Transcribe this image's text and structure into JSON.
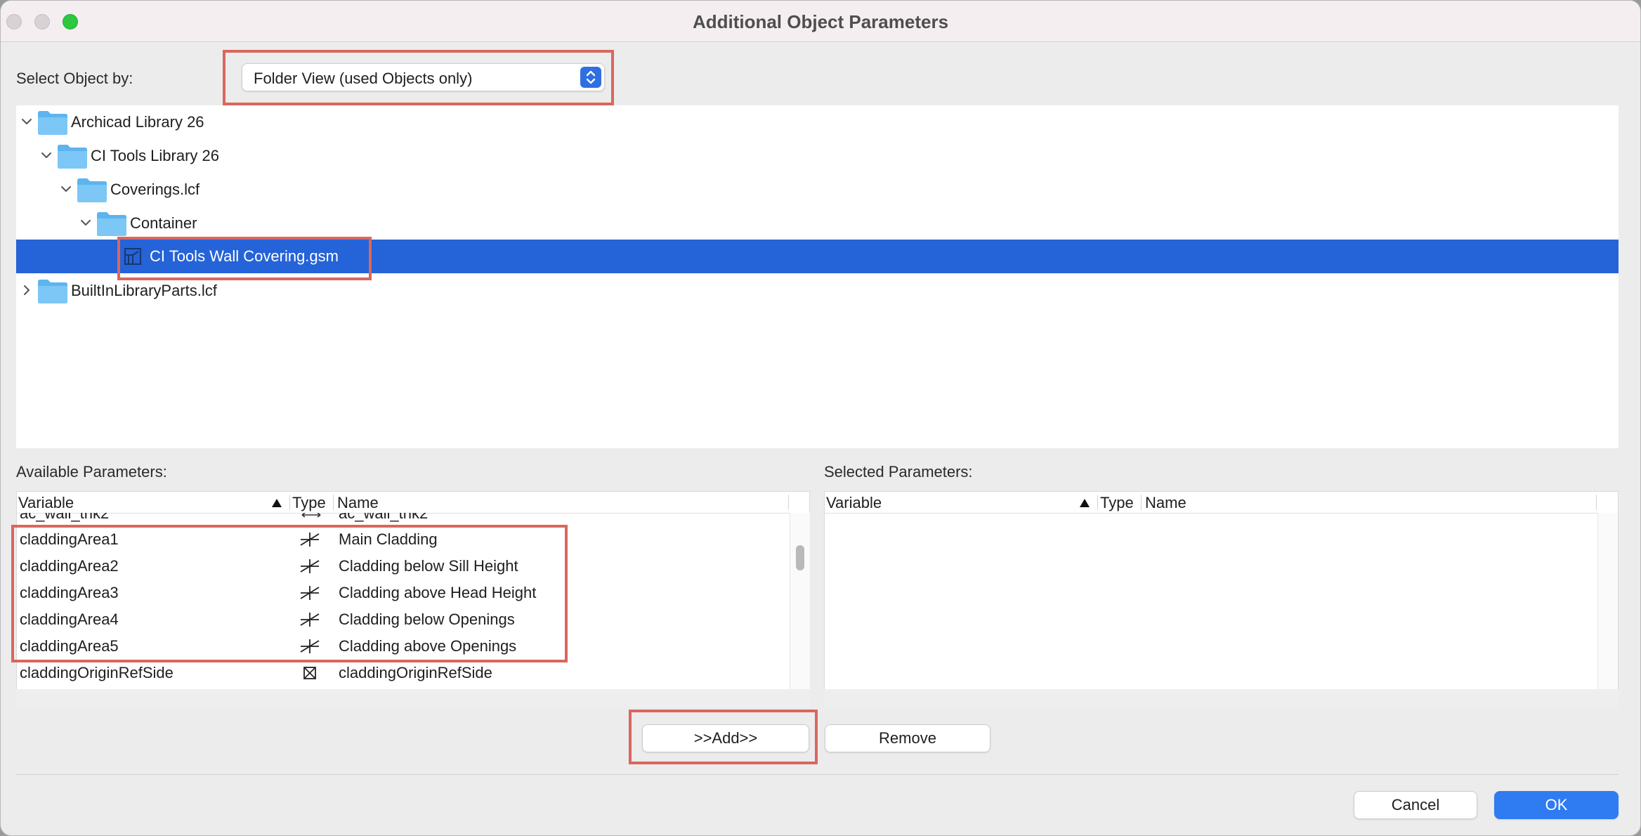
{
  "window": {
    "title": "Additional Object Parameters"
  },
  "select_by": {
    "label": "Select Object by:",
    "value": "Folder View (used Objects only)"
  },
  "tree": {
    "items": [
      {
        "label": "Archicad Library 26",
        "expanded": true,
        "icon": "folder-icon"
      },
      {
        "label": "CI Tools Library 26",
        "expanded": true,
        "icon": "folder-icon"
      },
      {
        "label": "Coverings.lcf",
        "expanded": true,
        "icon": "folder-icon"
      },
      {
        "label": "Container",
        "expanded": true,
        "icon": "folder-icon"
      },
      {
        "label": "CI Tools Wall Covering.gsm",
        "selected": true,
        "icon": "library-object-icon"
      },
      {
        "label": "BuiltInLibraryParts.lcf",
        "expanded": false,
        "icon": "folder-icon"
      }
    ]
  },
  "available": {
    "label": "Available Parameters:",
    "columns": {
      "variable": "Variable",
      "type": "Type",
      "name": "Name"
    },
    "partial_row": {
      "variable": "ac_wall_thk2",
      "name": "ac_wall_thk2"
    },
    "rows": [
      {
        "variable": "claddingArea1",
        "type_icon": "surface-icon",
        "name": "Main Cladding"
      },
      {
        "variable": "claddingArea2",
        "type_icon": "surface-icon",
        "name": "Cladding below Sill Height"
      },
      {
        "variable": "claddingArea3",
        "type_icon": "surface-icon",
        "name": "Cladding above Head Height"
      },
      {
        "variable": "claddingArea4",
        "type_icon": "surface-icon",
        "name": "Cladding below Openings"
      },
      {
        "variable": "claddingArea5",
        "type_icon": "surface-icon",
        "name": "Cladding above Openings"
      },
      {
        "variable": "claddingOriginRefSide",
        "type_icon": "boolean-icon",
        "name": "claddingOriginRefSide"
      }
    ]
  },
  "selected": {
    "label": "Selected Parameters:",
    "columns": {
      "variable": "Variable",
      "type": "Type",
      "name": "Name"
    }
  },
  "buttons": {
    "add": ">>Add>>",
    "remove": "Remove",
    "cancel": "Cancel",
    "ok": "OK"
  },
  "colors": {
    "selection": "#2563d8",
    "highlight_box": "#d9675d",
    "primary_button": "#2f7bf2",
    "folder": "#6fbef2"
  }
}
